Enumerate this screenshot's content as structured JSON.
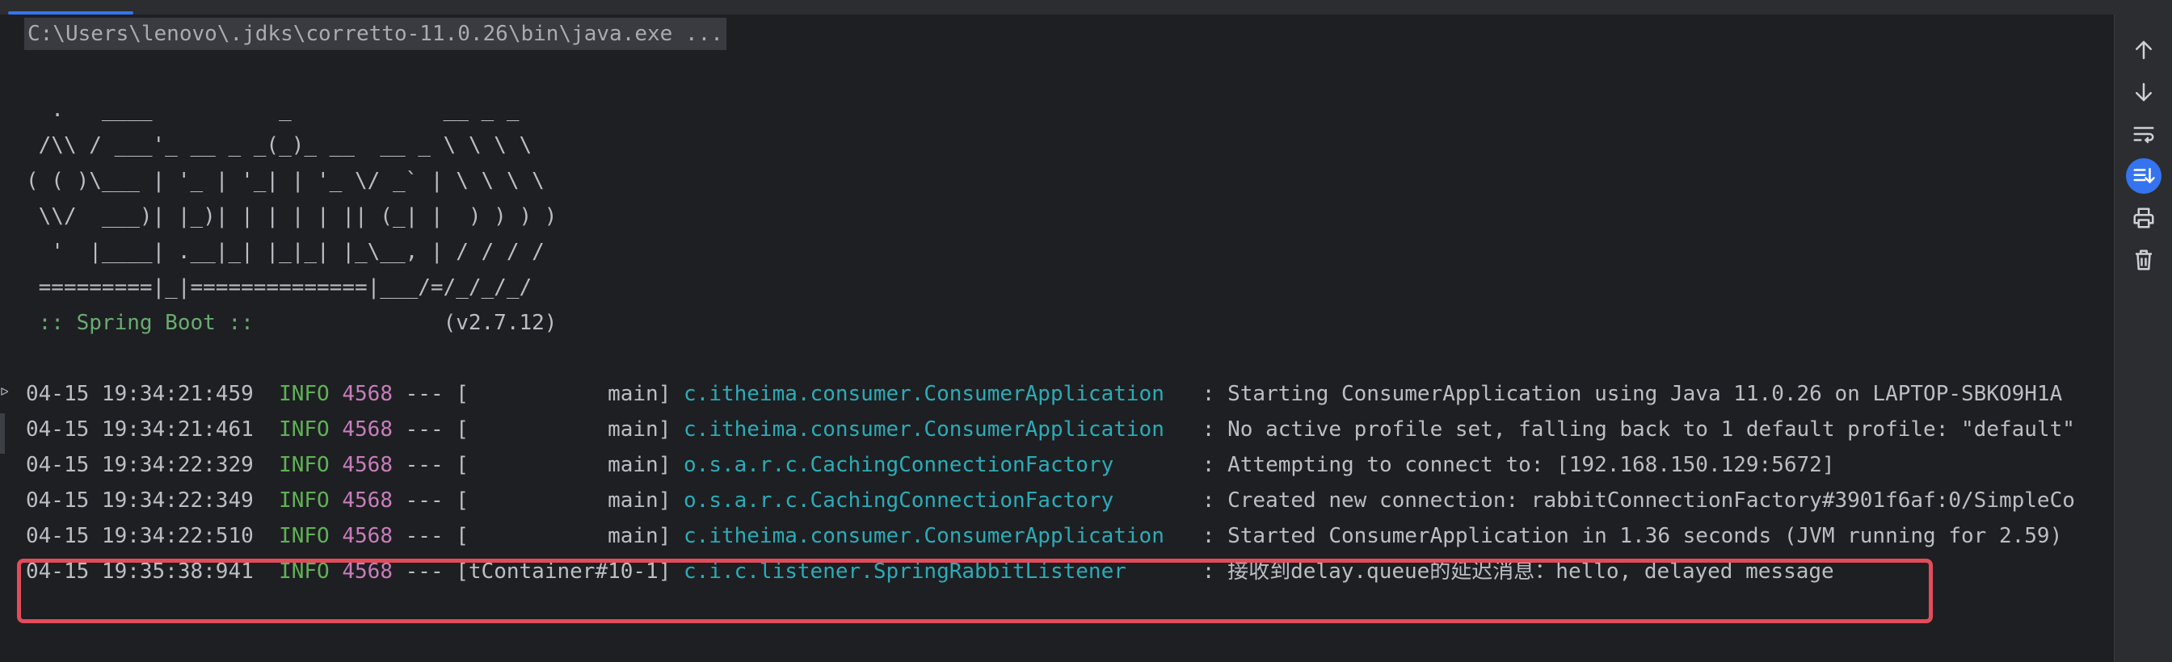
{
  "command": "C:\\Users\\lenovo\\.jdks\\corretto-11.0.26\\bin\\java.exe ...",
  "banner": [
    "  .   ____          _            __ _ _",
    " /\\\\ / ___'_ __ _ _(_)_ __  __ _ \\ \\ \\ \\",
    "( ( )\\___ | '_ | '_| | '_ \\/ _` | \\ \\ \\ \\",
    " \\\\/  ___)| |_)| | | | | || (_| |  ) ) ) )",
    "  '  |____| .__|_| |_|_| |_\\__, | / / / /",
    " =========|_|==============|___/=/_/_/_/"
  ],
  "spring_boot_label": " :: Spring Boot :: ",
  "spring_boot_version": "              (v2.7.12)",
  "logs": [
    {
      "ts": "04-15 19:34:21:459",
      "level": "INFO",
      "pid": "4568",
      "thread": " --- [           main] ",
      "logger": "c.itheima.consumer.ConsumerApplication  ",
      "msg": " : Starting ConsumerApplication using Java 11.0.26 on LAPTOP-SBKO9H1A"
    },
    {
      "ts": "04-15 19:34:21:461",
      "level": "INFO",
      "pid": "4568",
      "thread": " --- [           main] ",
      "logger": "c.itheima.consumer.ConsumerApplication  ",
      "msg": " : No active profile set, falling back to 1 default profile: \"default\""
    },
    {
      "ts": "04-15 19:34:22:329",
      "level": "INFO",
      "pid": "4568",
      "thread": " --- [           main] ",
      "logger": "o.s.a.r.c.CachingConnectionFactory      ",
      "msg": " : Attempting to connect to: [192.168.150.129:5672]"
    },
    {
      "ts": "04-15 19:34:22:349",
      "level": "INFO",
      "pid": "4568",
      "thread": " --- [           main] ",
      "logger": "o.s.a.r.c.CachingConnectionFactory      ",
      "msg": " : Created new connection: rabbitConnectionFactory#3901f6af:0/SimpleCo"
    },
    {
      "ts": "04-15 19:34:22:510",
      "level": "INFO",
      "pid": "4568",
      "thread": " --- [           main] ",
      "logger": "c.itheima.consumer.ConsumerApplication  ",
      "msg": " : Started ConsumerApplication in 1.36 seconds (JVM running for 2.59)"
    },
    {
      "ts": "04-15 19:35:38:941",
      "level": "INFO",
      "pid": "4568",
      "thread": " --- [tContainer#10-1] ",
      "logger": "c.i.c.listener.SpringRabbitListener     ",
      "msg": " : 接收到delay.queue的延迟消息：hello, delayed message"
    }
  ],
  "side_icons": [
    "arrow-up-icon",
    "arrow-down-icon",
    "soft-wrap-icon",
    "scroll-to-end-icon",
    "print-icon",
    "trash-icon"
  ],
  "colors": {
    "highlight": "#e24c5a",
    "logger": "#2aacb8",
    "level": "#5fb157",
    "pid": "#c77dbb",
    "spring": "#6aab73",
    "accent": "#3574f0"
  }
}
